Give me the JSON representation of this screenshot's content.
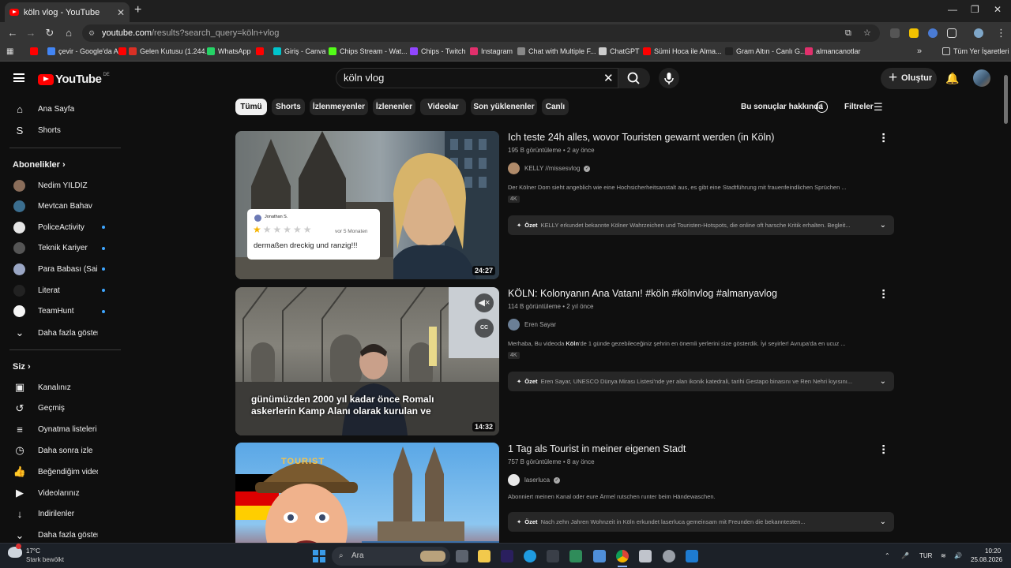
{
  "browser": {
    "tab_title": "köln vlog - YouTube",
    "url_host": "youtube.com",
    "url_path": "/results?search_query=köln+vlog",
    "minimize": "—",
    "restore": "❐",
    "close": "✕"
  },
  "bookmarks": [
    {
      "label": "",
      "color": "#ff0000"
    },
    {
      "label": "çevir - Google'da Ara",
      "color": "#4285f4"
    },
    {
      "label": "",
      "color": "#ff0000"
    },
    {
      "label": "Gelen Kutusu (1.244...",
      "color": "#d93025"
    },
    {
      "label": "WhatsApp",
      "color": "#25d366"
    },
    {
      "label": "",
      "color": "#ff0000"
    },
    {
      "label": "Giriş - Canva",
      "color": "#00c4cc"
    },
    {
      "label": "Chips Stream - Wat...",
      "color": "#53fc18"
    },
    {
      "label": "Chips - Twitch",
      "color": "#9146ff"
    },
    {
      "label": "Instagram",
      "color": "#e1306c"
    },
    {
      "label": "Chat with Multiple F...",
      "color": "#888888"
    },
    {
      "label": "ChatGPT",
      "color": "#cccccc"
    },
    {
      "label": "Sümi Hoca ile Alma...",
      "color": "#ff0000"
    },
    {
      "label": "Gram Altın - Canlı G...",
      "color": "#222222"
    },
    {
      "label": "almancanotlar",
      "color": "#e1306c"
    }
  ],
  "bookmarks_all": "Tüm Yer İşaretleri",
  "youtube": {
    "logo_text": "YouTube",
    "logo_region": "DE",
    "search_query": "köln vlog",
    "create_label": "Oluştur"
  },
  "sidebar": {
    "main": [
      {
        "label": "Ana Sayfa",
        "icon": "⌂"
      },
      {
        "label": "Shorts",
        "icon": "S"
      }
    ],
    "subs_title": "Abonelikler",
    "subs": [
      {
        "label": "Nedim YILDIZ",
        "dot": false,
        "color": "#8a6d5a"
      },
      {
        "label": "Mevtcan Bahav",
        "dot": false,
        "color": "#3b6e8f"
      },
      {
        "label": "PoliceActivity",
        "dot": true,
        "color": "#e6e6e6"
      },
      {
        "label": "Teknik Kariyer",
        "dot": true,
        "color": "#555555"
      },
      {
        "label": "Para Babası (Sai...",
        "dot": true,
        "color": "#9aa6c4"
      },
      {
        "label": "Literat",
        "dot": true,
        "color": "#222222"
      },
      {
        "label": "TeamHunt",
        "dot": true,
        "color": "#f5f5f5"
      }
    ],
    "subs_more": "Daha fazla göster",
    "you_title": "Siz",
    "you": [
      {
        "label": "Kanalınız",
        "icon": "▣"
      },
      {
        "label": "Geçmiş",
        "icon": "↺"
      },
      {
        "label": "Oynatma listeleri",
        "icon": "≡"
      },
      {
        "label": "Daha sonra izle",
        "icon": "◷"
      },
      {
        "label": "Beğendiğim videolar",
        "icon": "👍"
      },
      {
        "label": "Videolarınız",
        "icon": "▶"
      },
      {
        "label": "İndirilenler",
        "icon": "↓"
      },
      {
        "label": "Daha fazla göster",
        "icon": "⌄"
      }
    ]
  },
  "chips": [
    "Tümü",
    "Shorts",
    "İzlenmeyenler",
    "İzlenenler",
    "Videolar",
    "Son yüklenenler",
    "Canlı"
  ],
  "about_results": "Bu sonuçlar hakkında",
  "filters_label": "Filtreler",
  "results": [
    {
      "title": "Ich teste 24h alles, wovor Touristen gewarnt werden (in Köln)",
      "meta": "195 B görüntüleme • 2 ay önce",
      "channel": "KELLY //missesvlog",
      "verified": true,
      "desc": "Der Kölner Dom sieht angeblich wie eine Hochsicherheitsanstalt aus, es gibt eine Stadtführung mit frauenfeindlichen Sprüchen ...",
      "badge": "4K",
      "summary_label": "Özet",
      "summary": "KELLY erkundet bekannte Kölner Wahrzeichen und Touristen-Hotspots, die online oft harsche Kritik erhalten. Begleit...",
      "duration": "24:27",
      "overlay_name": "Jonathan S.",
      "overlay_time": "vor 5 Monaten",
      "overlay_text": "dermaßen dreckig und ranzig!!!"
    },
    {
      "title": "KÖLN: Kolonyanın Ana Vatanı! #köln #kölnvlog #almanyavlog",
      "meta": "114 B görüntüleme • 2 yıl önce",
      "channel": "Eren Sayar",
      "verified": false,
      "desc_pre": "Merhaba, Bu videoda ",
      "desc_bold": "Köln",
      "desc_post": "'de 1 günde gezebileceğiniz şehrin en önemli yerlerini size gösterdik. İyi seyirler! Avrupa'da en ucuz ...",
      "badge": "4K",
      "summary_label": "Özet",
      "summary": "Eren Sayar, UNESCO Dünya Mirası Listesi'nde yer alan ikonik katedrali, tarihi Gestapo binasını ve Ren Nehri kıyısını...",
      "duration": "14:32",
      "caption": "günümüzden 2000 yıl kadar önce Romalı askerlerin Kamp Alanı olarak kurulan ve",
      "cc": "CC"
    },
    {
      "title": "1 Tag als Tourist in meiner eigenen Stadt",
      "meta": "757 B görüntüleme • 8 ay önce",
      "channel": "laserluca",
      "verified": true,
      "desc": "Abonniert meinen Kanal oder eure Ärmel rutschen runter beim Händewaschen.",
      "summary_label": "Özet",
      "summary": "Nach zehn Jahren Wohnzeit in Köln erkundet laserluca gemeinsam mit Freunden die bekanntesten...",
      "cap_text": "TOURIST"
    }
  ],
  "taskbar": {
    "temp": "17°C",
    "weather": "Stark bewölkt",
    "search": "Ara",
    "lang": "TUR",
    "time": "10:20",
    "date": "25.08.2026"
  }
}
